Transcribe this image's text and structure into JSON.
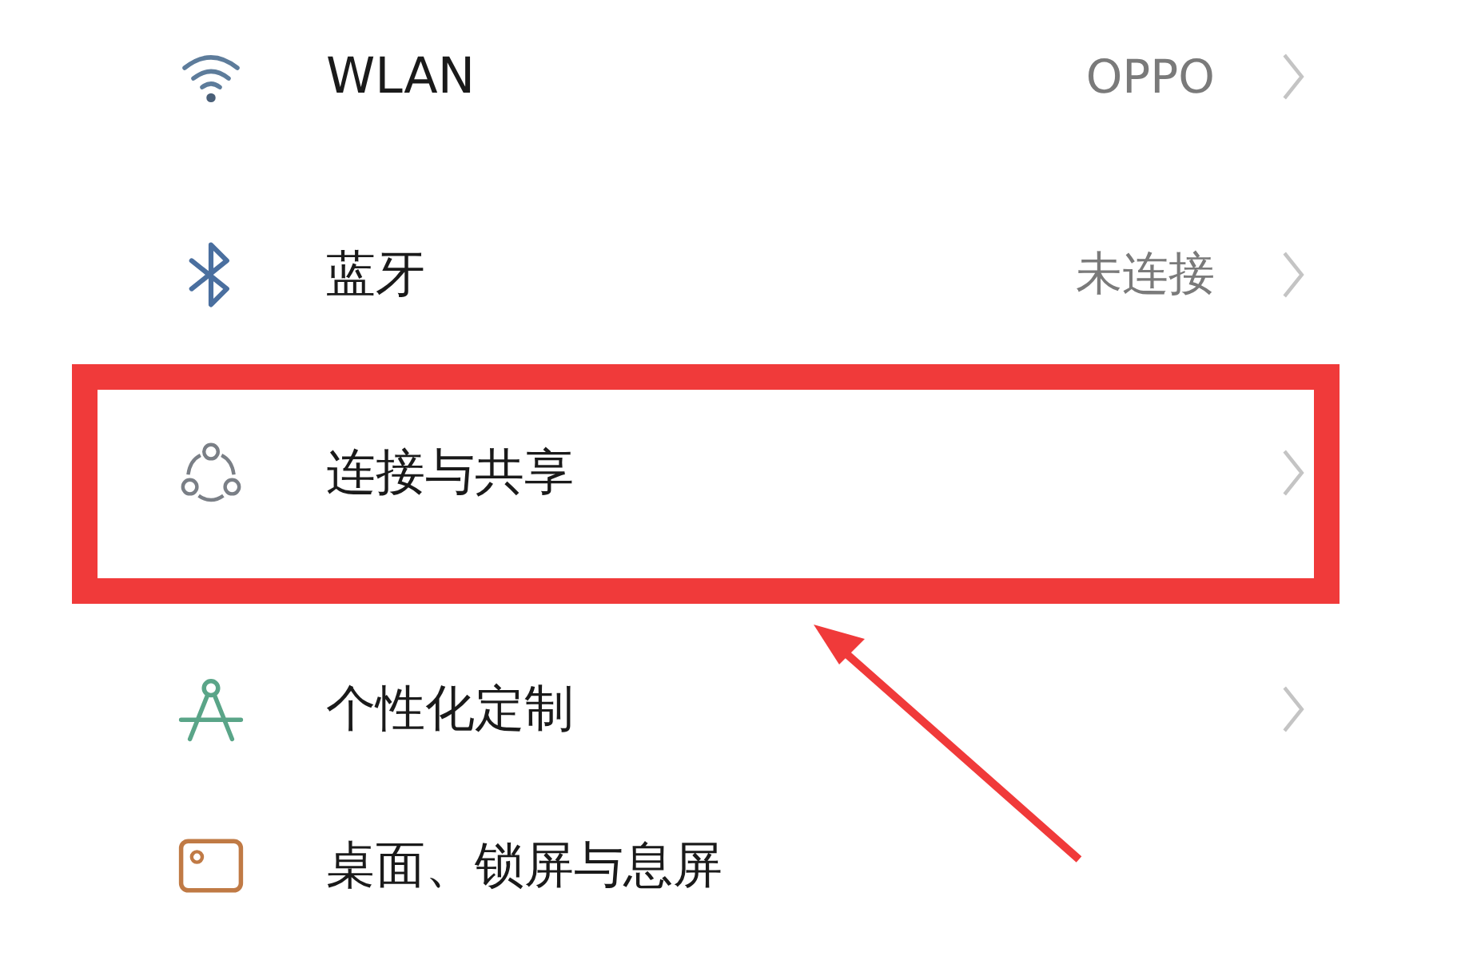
{
  "settings_items": [
    {
      "kind": "wifi",
      "label": "WLAN",
      "value": "OPPO",
      "highlighted": false
    },
    {
      "kind": "bluetooth",
      "label": "蓝牙",
      "value": "未连接",
      "highlighted": false
    },
    {
      "kind": "share",
      "label": "连接与共享",
      "highlighted": true
    },
    {
      "kind": "compass",
      "label": "个性化定制",
      "highlighted": false
    },
    {
      "kind": "picture",
      "label": "桌面、锁屏与息屏",
      "highlighted": false
    }
  ]
}
